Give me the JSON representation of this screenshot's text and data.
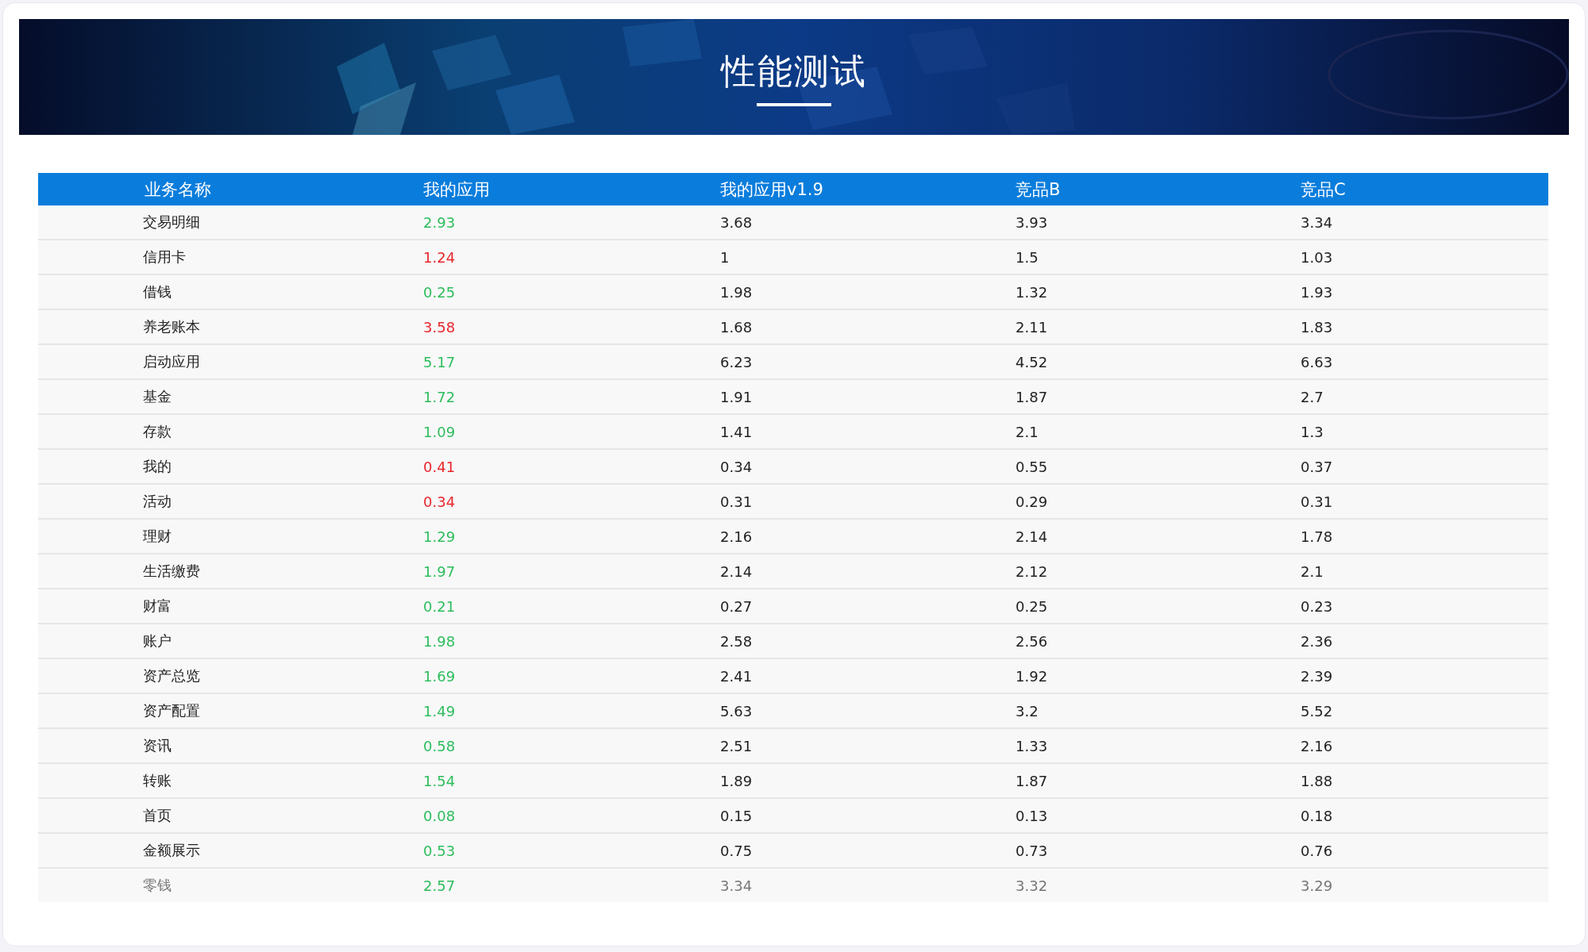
{
  "banner": {
    "title": "性能测试"
  },
  "table": {
    "columns": [
      "业务名称",
      "我的应用",
      "我的应用v1.9",
      "竞品B",
      "竞品C"
    ],
    "rows": [
      {
        "cells": [
          "交易明细",
          "2.93",
          "3.68",
          "3.93",
          "3.34"
        ],
        "color": "#2dbd5c"
      },
      {
        "cells": [
          "信用卡",
          "1.24",
          "1",
          "1.5",
          "1.03"
        ],
        "color": "#e8262c"
      },
      {
        "cells": [
          "借钱",
          "0.25",
          "1.98",
          "1.32",
          "1.93"
        ],
        "color": "#2dbd5c"
      },
      {
        "cells": [
          "养老账本",
          "3.58",
          "1.68",
          "2.11",
          "1.83"
        ],
        "color": "#e8262c"
      },
      {
        "cells": [
          "启动应用",
          "5.17",
          "6.23",
          "4.52",
          "6.63"
        ],
        "color": "#2dbd5c"
      },
      {
        "cells": [
          "基金",
          "1.72",
          "1.91",
          "1.87",
          "2.7"
        ],
        "color": "#2dbd5c"
      },
      {
        "cells": [
          "存款",
          "1.09",
          "1.41",
          "2.1",
          "1.3"
        ],
        "color": "#2dbd5c"
      },
      {
        "cells": [
          "我的",
          "0.41",
          "0.34",
          "0.55",
          "0.37"
        ],
        "color": "#e8262c"
      },
      {
        "cells": [
          "活动",
          "0.34",
          "0.31",
          "0.29",
          "0.31"
        ],
        "color": "#e8262c"
      },
      {
        "cells": [
          "理财",
          "1.29",
          "2.16",
          "2.14",
          "1.78"
        ],
        "color": "#2dbd5c"
      },
      {
        "cells": [
          "生活缴费",
          "1.97",
          "2.14",
          "2.12",
          "2.1"
        ],
        "color": "#2dbd5c"
      },
      {
        "cells": [
          "财富",
          "0.21",
          "0.27",
          "0.25",
          "0.23"
        ],
        "color": "#2dbd5c"
      },
      {
        "cells": [
          "账户",
          "1.98",
          "2.58",
          "2.56",
          "2.36"
        ],
        "color": "#2dbd5c"
      },
      {
        "cells": [
          "资产总览",
          "1.69",
          "2.41",
          "1.92",
          "2.39"
        ],
        "color": "#2dbd5c"
      },
      {
        "cells": [
          "资产配置",
          "1.49",
          "5.63",
          "3.2",
          "5.52"
        ],
        "color": "#2dbd5c"
      },
      {
        "cells": [
          "资讯",
          "0.58",
          "2.51",
          "1.33",
          "2.16"
        ],
        "color": "#2dbd5c"
      },
      {
        "cells": [
          "转账",
          "1.54",
          "1.89",
          "1.87",
          "1.88"
        ],
        "color": "#2dbd5c"
      },
      {
        "cells": [
          "首页",
          "0.08",
          "0.15",
          "0.13",
          "0.18"
        ],
        "color": "#2dbd5c"
      },
      {
        "cells": [
          "金额展示",
          "0.53",
          "0.75",
          "0.73",
          "0.76"
        ],
        "color": "#2dbd5c"
      },
      {
        "cells": [
          "零钱",
          "2.57",
          "3.34",
          "3.32",
          "3.29"
        ],
        "color": "#2dbd5c"
      }
    ]
  }
}
